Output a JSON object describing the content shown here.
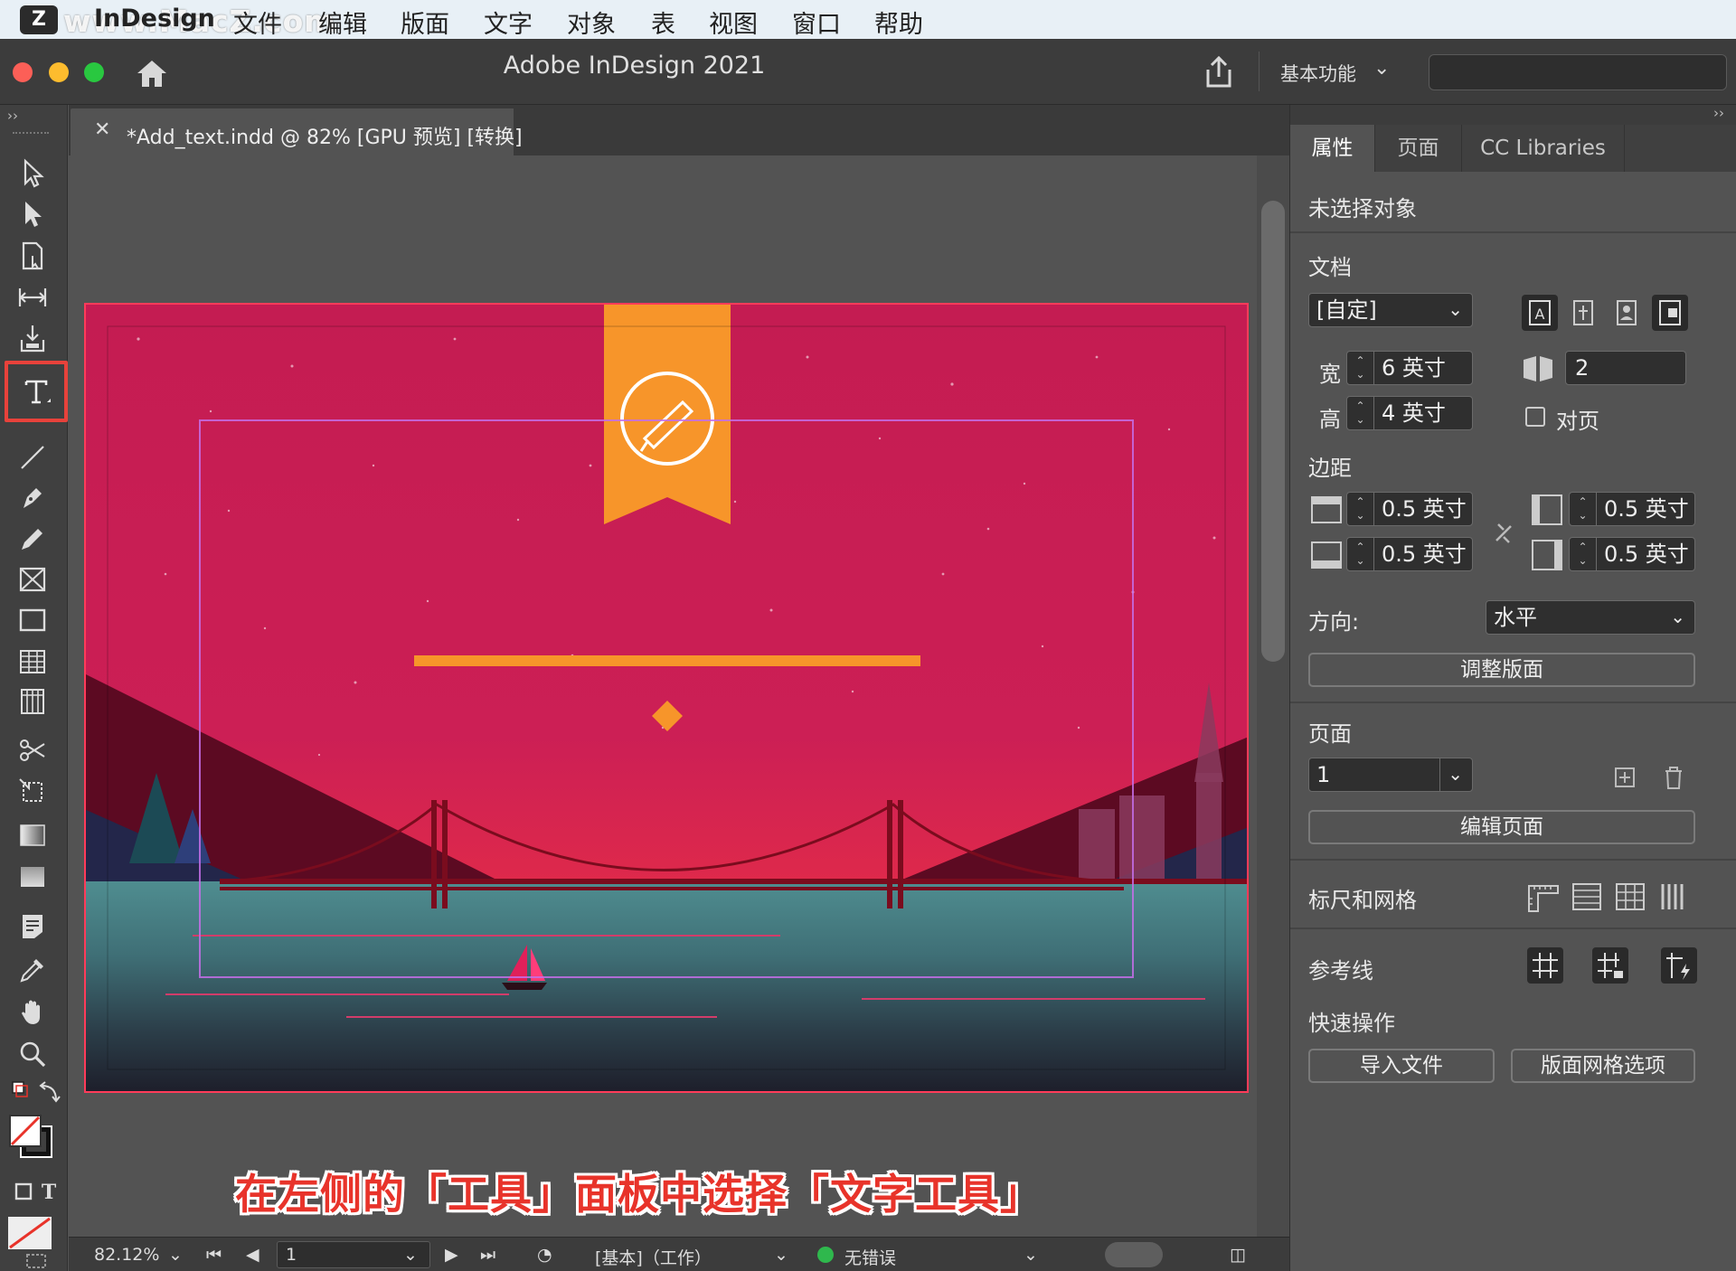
{
  "menubar": {
    "watermark": "www.MacZ.com",
    "app_name": "InDesign",
    "items": [
      "文件",
      "编辑",
      "版面",
      "文字",
      "对象",
      "表",
      "视图",
      "窗口",
      "帮助"
    ]
  },
  "titlebar": {
    "title": "Adobe InDesign 2021",
    "workspace": "基本功能"
  },
  "document": {
    "tab_title": "*Add_text.indd @ 82% [GPU 预览] [转换]"
  },
  "caption": "在左侧的「工具」面板中选择「文字工具」",
  "statusbar": {
    "zoom": "82.12%",
    "page": "1",
    "preflight_profile": "[基本]（工作）",
    "error_status": "无错误"
  },
  "panel": {
    "tabs": [
      "属性",
      "页面",
      "CC Libraries"
    ],
    "active_tab": "属性",
    "no_selection": "未选择对象",
    "document_section": "文档",
    "preset": "[自定]",
    "width_label": "宽",
    "width_value": "6 英寸",
    "height_label": "高",
    "height_value": "4 英寸",
    "pages_count": "2",
    "facing_pages_label": "对页",
    "margins_section": "边距",
    "margin_top": "0.5 英寸",
    "margin_bottom": "0.5 英寸",
    "margin_left": "0.5 英寸",
    "margin_right": "0.5 英寸",
    "orientation_label": "方向:",
    "orientation_value": "水平",
    "adjust_layout_button": "调整版面",
    "pages_section": "页面",
    "page_select": "1",
    "edit_page_button": "编辑页面",
    "rulers_grids_section": "标尺和网格",
    "guides_section": "参考线",
    "quick_actions_section": "快速操作",
    "import_file_button": "导入文件",
    "layout_grid_button": "版面网格选项"
  },
  "colors": {
    "accent_highlight": "#e8423b",
    "artboard_sky": "#c81e55",
    "ribbon": "#f7952a"
  }
}
